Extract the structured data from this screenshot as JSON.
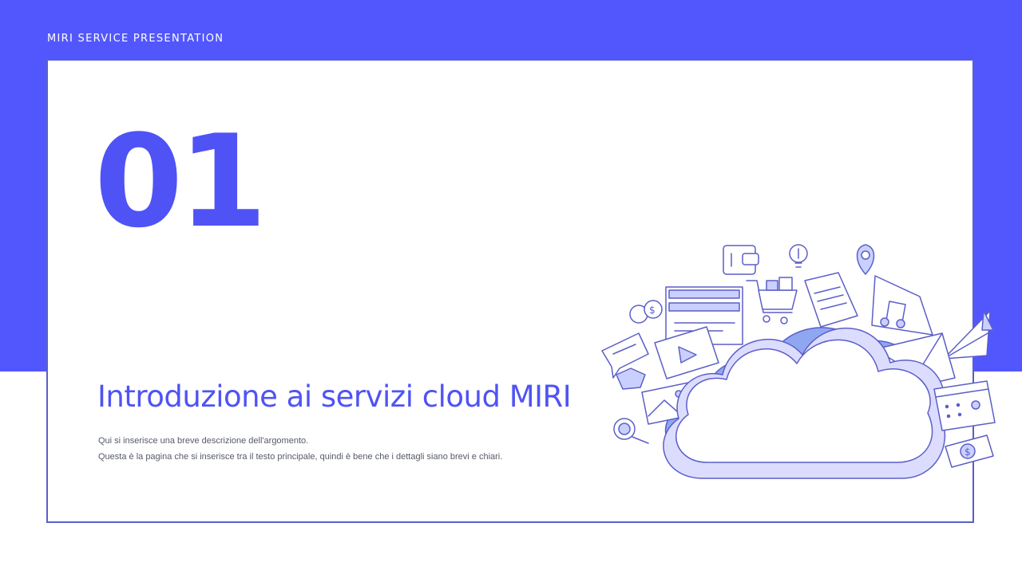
{
  "header": {
    "label": "MIRI SERVICE PRESENTATION"
  },
  "slide": {
    "number": "01",
    "title": "Introduzione ai servizi cloud MIRI",
    "description": [
      "Qui si inserisce una breve descrizione dell'argomento.",
      "Questa è la pagina che si inserisce tra il testo principale, quindi è bene che i dettagli siano brevi e chiari."
    ]
  },
  "colors": {
    "accent": "#5257fd",
    "accent_text": "#4f53f5",
    "border": "#5b5fc7",
    "cloud_shadow": "#dcdcff",
    "cloud_back": "#8fa7f0",
    "background": "#ffffff"
  },
  "illustration": {
    "icons": [
      "cloud-icon",
      "wallet-icon",
      "lightbulb-icon",
      "location-pin-icon",
      "coins-icon",
      "video-player-icon",
      "shopping-cart-icon",
      "document-icon",
      "music-folder-icon",
      "paper-plane-icon",
      "envelope-icon",
      "chat-like-icon",
      "photo-icon",
      "magnifier-icon",
      "calendar-icon",
      "money-icon"
    ]
  }
}
